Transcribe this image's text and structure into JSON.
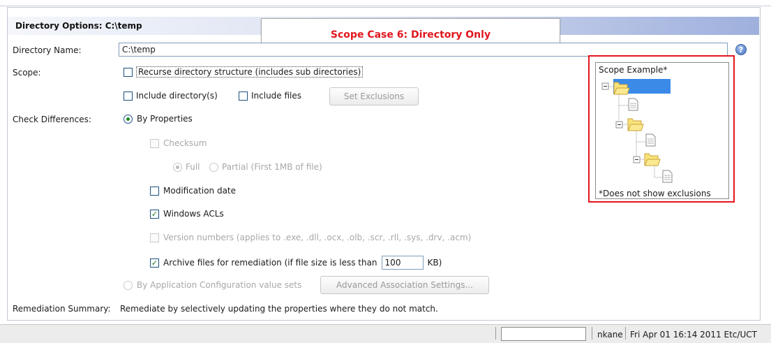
{
  "header": {
    "title": "Directory Options: C:\\temp"
  },
  "callout": {
    "text": "Scope Case 6: Directory Only"
  },
  "directory_name": {
    "label": "Directory Name:",
    "value": "C:\\temp"
  },
  "scope": {
    "label": "Scope:",
    "recurse_label": "Recurse directory structure (includes sub directories)",
    "recurse_checked": false,
    "include_dirs_label": "Include directory(s)",
    "include_dirs_checked": false,
    "include_files_label": "Include files",
    "include_files_checked": false,
    "set_exclusions_label": "Set Exclusions"
  },
  "check_differences": {
    "label": "Check Differences:",
    "by_properties_label": "By Properties",
    "by_properties_selected": true,
    "checksum_label": "Checksum",
    "full_label": "Full",
    "partial_label": "Partial (First 1MB of file)",
    "modification_date_label": "Modification date",
    "windows_acls_label": "Windows ACLs",
    "windows_acls_checked": true,
    "version_numbers_label": "Version numbers (applies to .exe, .dll, .ocx, .olb, .scr, .rll, .sys, .drv, .acm)",
    "archive_label": "Archive files for remediation (if file size is less than",
    "archive_checked": true,
    "archive_size": "100",
    "archive_unit": "KB)",
    "by_app_config_label": "By Application Configuration value sets",
    "advanced_button_label": "Advanced Association Settings..."
  },
  "remediation": {
    "label": "Remediation Summary:",
    "text": "Remediate by selectively updating the properties where they do not match."
  },
  "scope_example": {
    "title": "Scope Example*",
    "note": "*Does not show exclusions"
  },
  "statusbar": {
    "user": "nkane",
    "datetime": "Fri Apr 01 16:14 2011 Etc/UCT"
  },
  "colors": {
    "callout_text": "#e0161d",
    "highlight_box": "#e3161d",
    "tree_selection": "#3b8ae8",
    "check_mark": "#1c7a21"
  }
}
